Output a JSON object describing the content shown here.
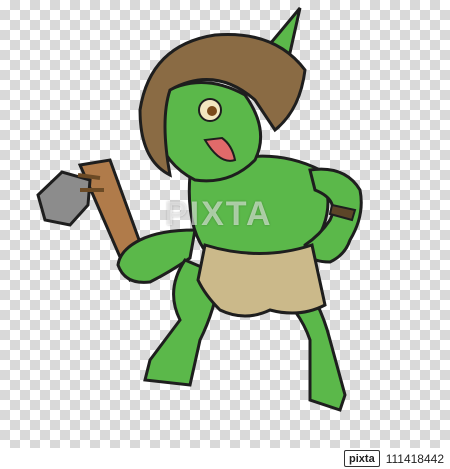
{
  "watermark": {
    "text": "PIXTA"
  },
  "footer": {
    "brand": "pixta",
    "image_id": "111418442"
  },
  "colors": {
    "skin": "#5bb84a",
    "skin_dark": "#3e8d33",
    "hood": "#8a6b44",
    "hood_dark": "#5c4528",
    "loincloth": "#cbb98a",
    "stone": "#8c8c8c",
    "tongue": "#e06a6a"
  },
  "icons": [
    "goblin-character",
    "stone-axe"
  ]
}
